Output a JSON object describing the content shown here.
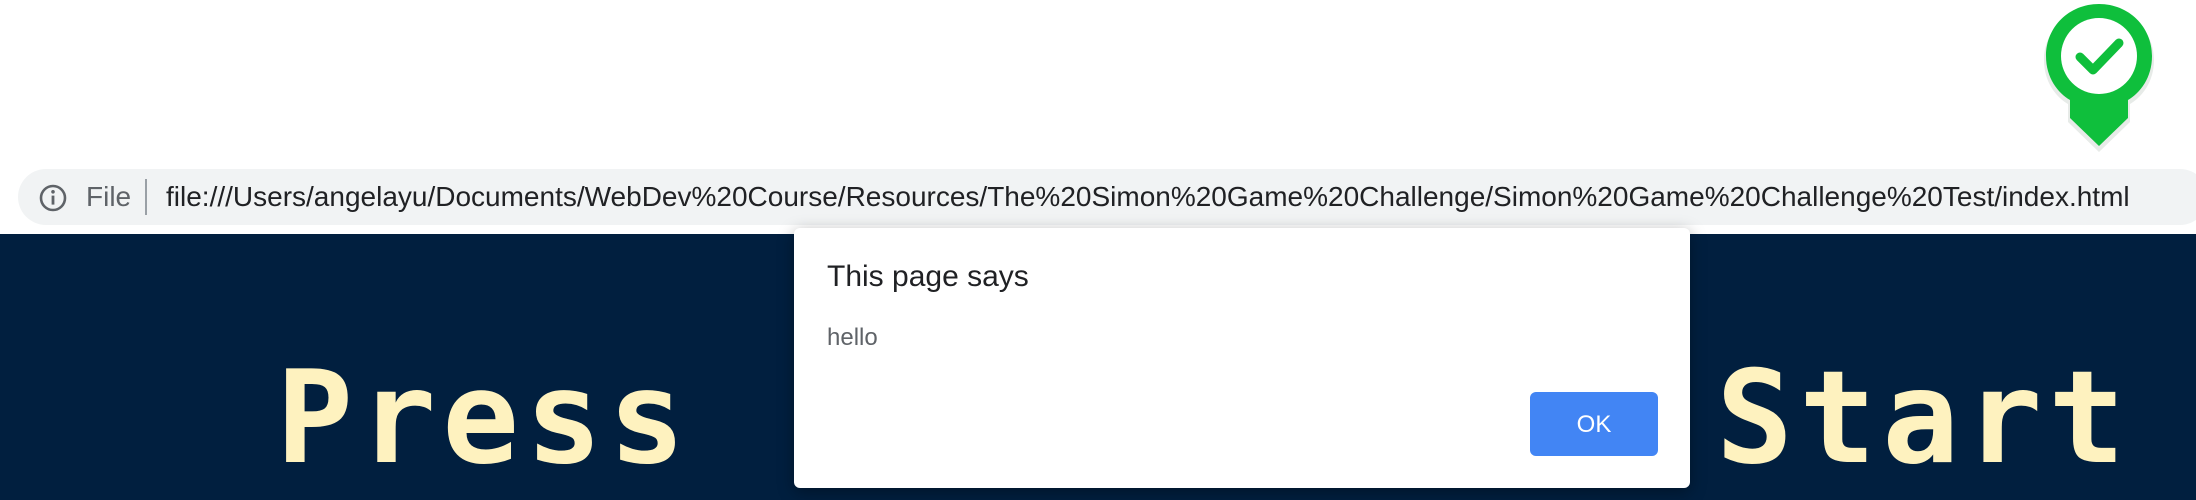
{
  "browser": {
    "scheme_label": "File",
    "url": "file:///Users/angelayu/Documents/WebDev%20Course/Resources/The%20Simon%20Game%20Challenge/Simon%20Game%20Challenge%20Test/index.html"
  },
  "page": {
    "title_left": "Press",
    "title_right": "Start"
  },
  "alert": {
    "heading": "This page says",
    "message": "hello",
    "ok_label": "OK"
  },
  "colors": {
    "page_background": "#011f3f",
    "title_color": "#fef2bf",
    "ok_button": "#4285f4",
    "marker_green": "#0fbf3c"
  },
  "icons": {
    "omnibox_icon": "info-icon",
    "marker_icon": "check-icon"
  }
}
